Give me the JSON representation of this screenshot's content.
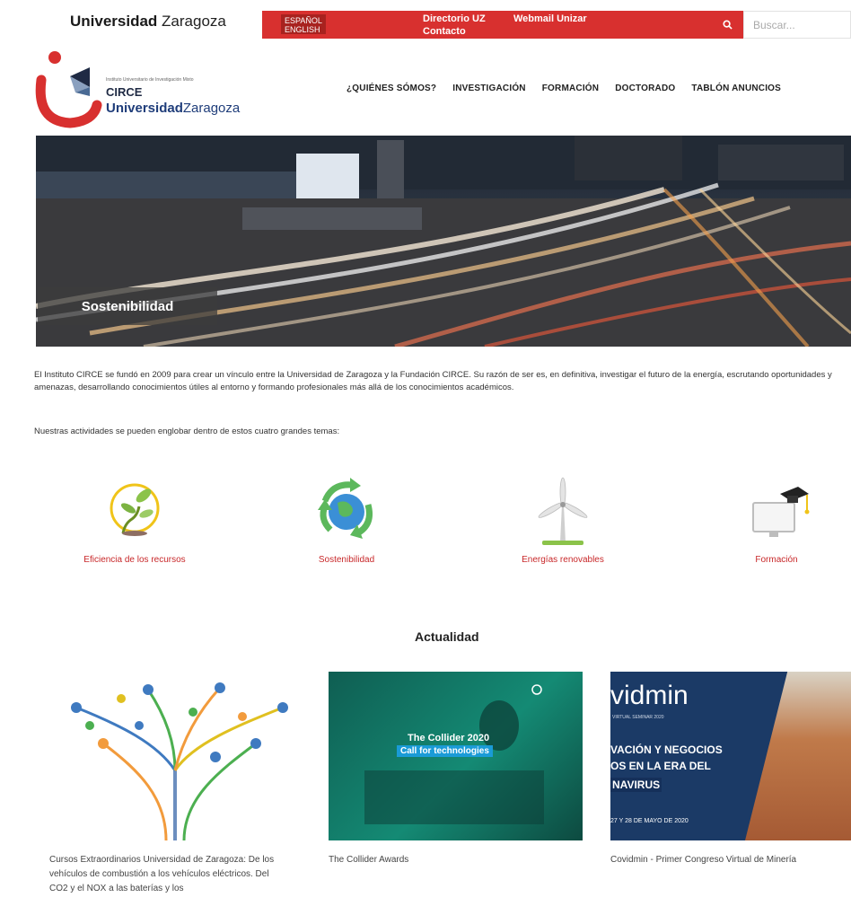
{
  "topbar": {
    "brand_bold": "Universidad",
    "brand_rest": "Zaragoza",
    "lang_line1": "ESPAÑOL",
    "lang_line2": "ENGLISH",
    "links": [
      "Directorio UZ",
      "Webmail Unizar",
      "Contacto"
    ],
    "search_placeholder": "Buscar..."
  },
  "header": {
    "logo_small": "Instituto Universitario de Investigación Mixto",
    "logo_circe": "CIRCE",
    "logo_uz_bold": "Universidad",
    "logo_uz_rest": "Zaragoza",
    "nav": [
      "¿QUIÉNES SÓMOS?",
      "INVESTIGACIÓN",
      "FORMACIÓN",
      "DOCTORADO",
      "TABLÓN ANUNCIOS"
    ]
  },
  "hero": {
    "caption": "Sostenibilidad"
  },
  "intro": {
    "paragraph": "El Instituto CIRCE se fundó en 2009 para crear un vínculo entre la Universidad de Zaragoza y la Fundación CIRCE. Su razón de ser es, en definitiva, investigar el futuro de la energía, escrutando oportunidades y amenazas, desarrollando conocimientos útiles al entorno y formando profesionales más allá de los conocimientos académicos.",
    "lead": "Nuestras actividades se pueden englobar dentro de estos cuatro grandes temas:"
  },
  "themes": [
    {
      "label": "Eficiencia de los recursos",
      "icon": "plant-icon"
    },
    {
      "label": "Sostenibilidad",
      "icon": "recycle-globe-icon"
    },
    {
      "label": "Energías renovables",
      "icon": "wind-turbine-icon"
    },
    {
      "label": "Formación",
      "icon": "graduation-cap-icon"
    }
  ],
  "news_section": {
    "title": "Actualidad",
    "items": [
      {
        "caption": "Cursos Extraordinarios Universidad de Zaragoza: De los vehículos de combustión a los vehículos eléctricos. Del CO2 y el NOX a las baterías y los"
      },
      {
        "caption": "The Collider Awards",
        "img_line1": "The Collider 2020",
        "img_line2": "Call for technologies"
      },
      {
        "caption": "Covidmin - Primer Congreso Virtual de Minería",
        "img_brand": "vidmin",
        "img_sub": "VIRTUAL SEMINAR 2020",
        "img_line1": "VACIÓN Y NEGOCIOS",
        "img_line2": "OS EN LA ERA DEL",
        "img_line3": "NAVIRUS",
        "img_date": "27 Y 28 DE MAYO DE 2020"
      }
    ]
  },
  "colors": {
    "accent_red": "#d8302f",
    "label_red": "#c8282a",
    "navy": "#1f3d7a"
  }
}
